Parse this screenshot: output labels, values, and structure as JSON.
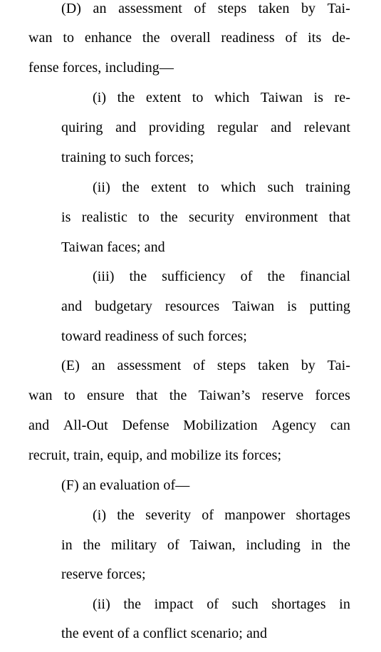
{
  "document": {
    "lines": [
      "(D) an assessment of steps taken by Tai-",
      "wan to enhance the overall readiness of its de-",
      "fense forces, including—",
      "(i) the extent to which Taiwan is re-",
      "quiring and providing regular and relevant",
      "training to such forces;",
      "(ii) the extent to which such training",
      "is realistic to the security environment that",
      "Taiwan faces; and",
      "(iii) the sufficiency of the financial",
      "and budgetary resources Taiwan is putting",
      "toward readiness of such forces;",
      "(E) an assessment of steps taken by Tai-",
      "wan to ensure that the Taiwan’s reserve forces",
      "and All-Out Defense Mobilization Agency can",
      "recruit, train, equip, and mobilize its forces;",
      "(F) an evaluation of—",
      "(i) the severity of manpower shortages",
      "in the military of Taiwan, including in the",
      "reserve forces;",
      "(ii) the impact of such shortages in",
      "the event of a conflict scenario; and"
    ]
  }
}
